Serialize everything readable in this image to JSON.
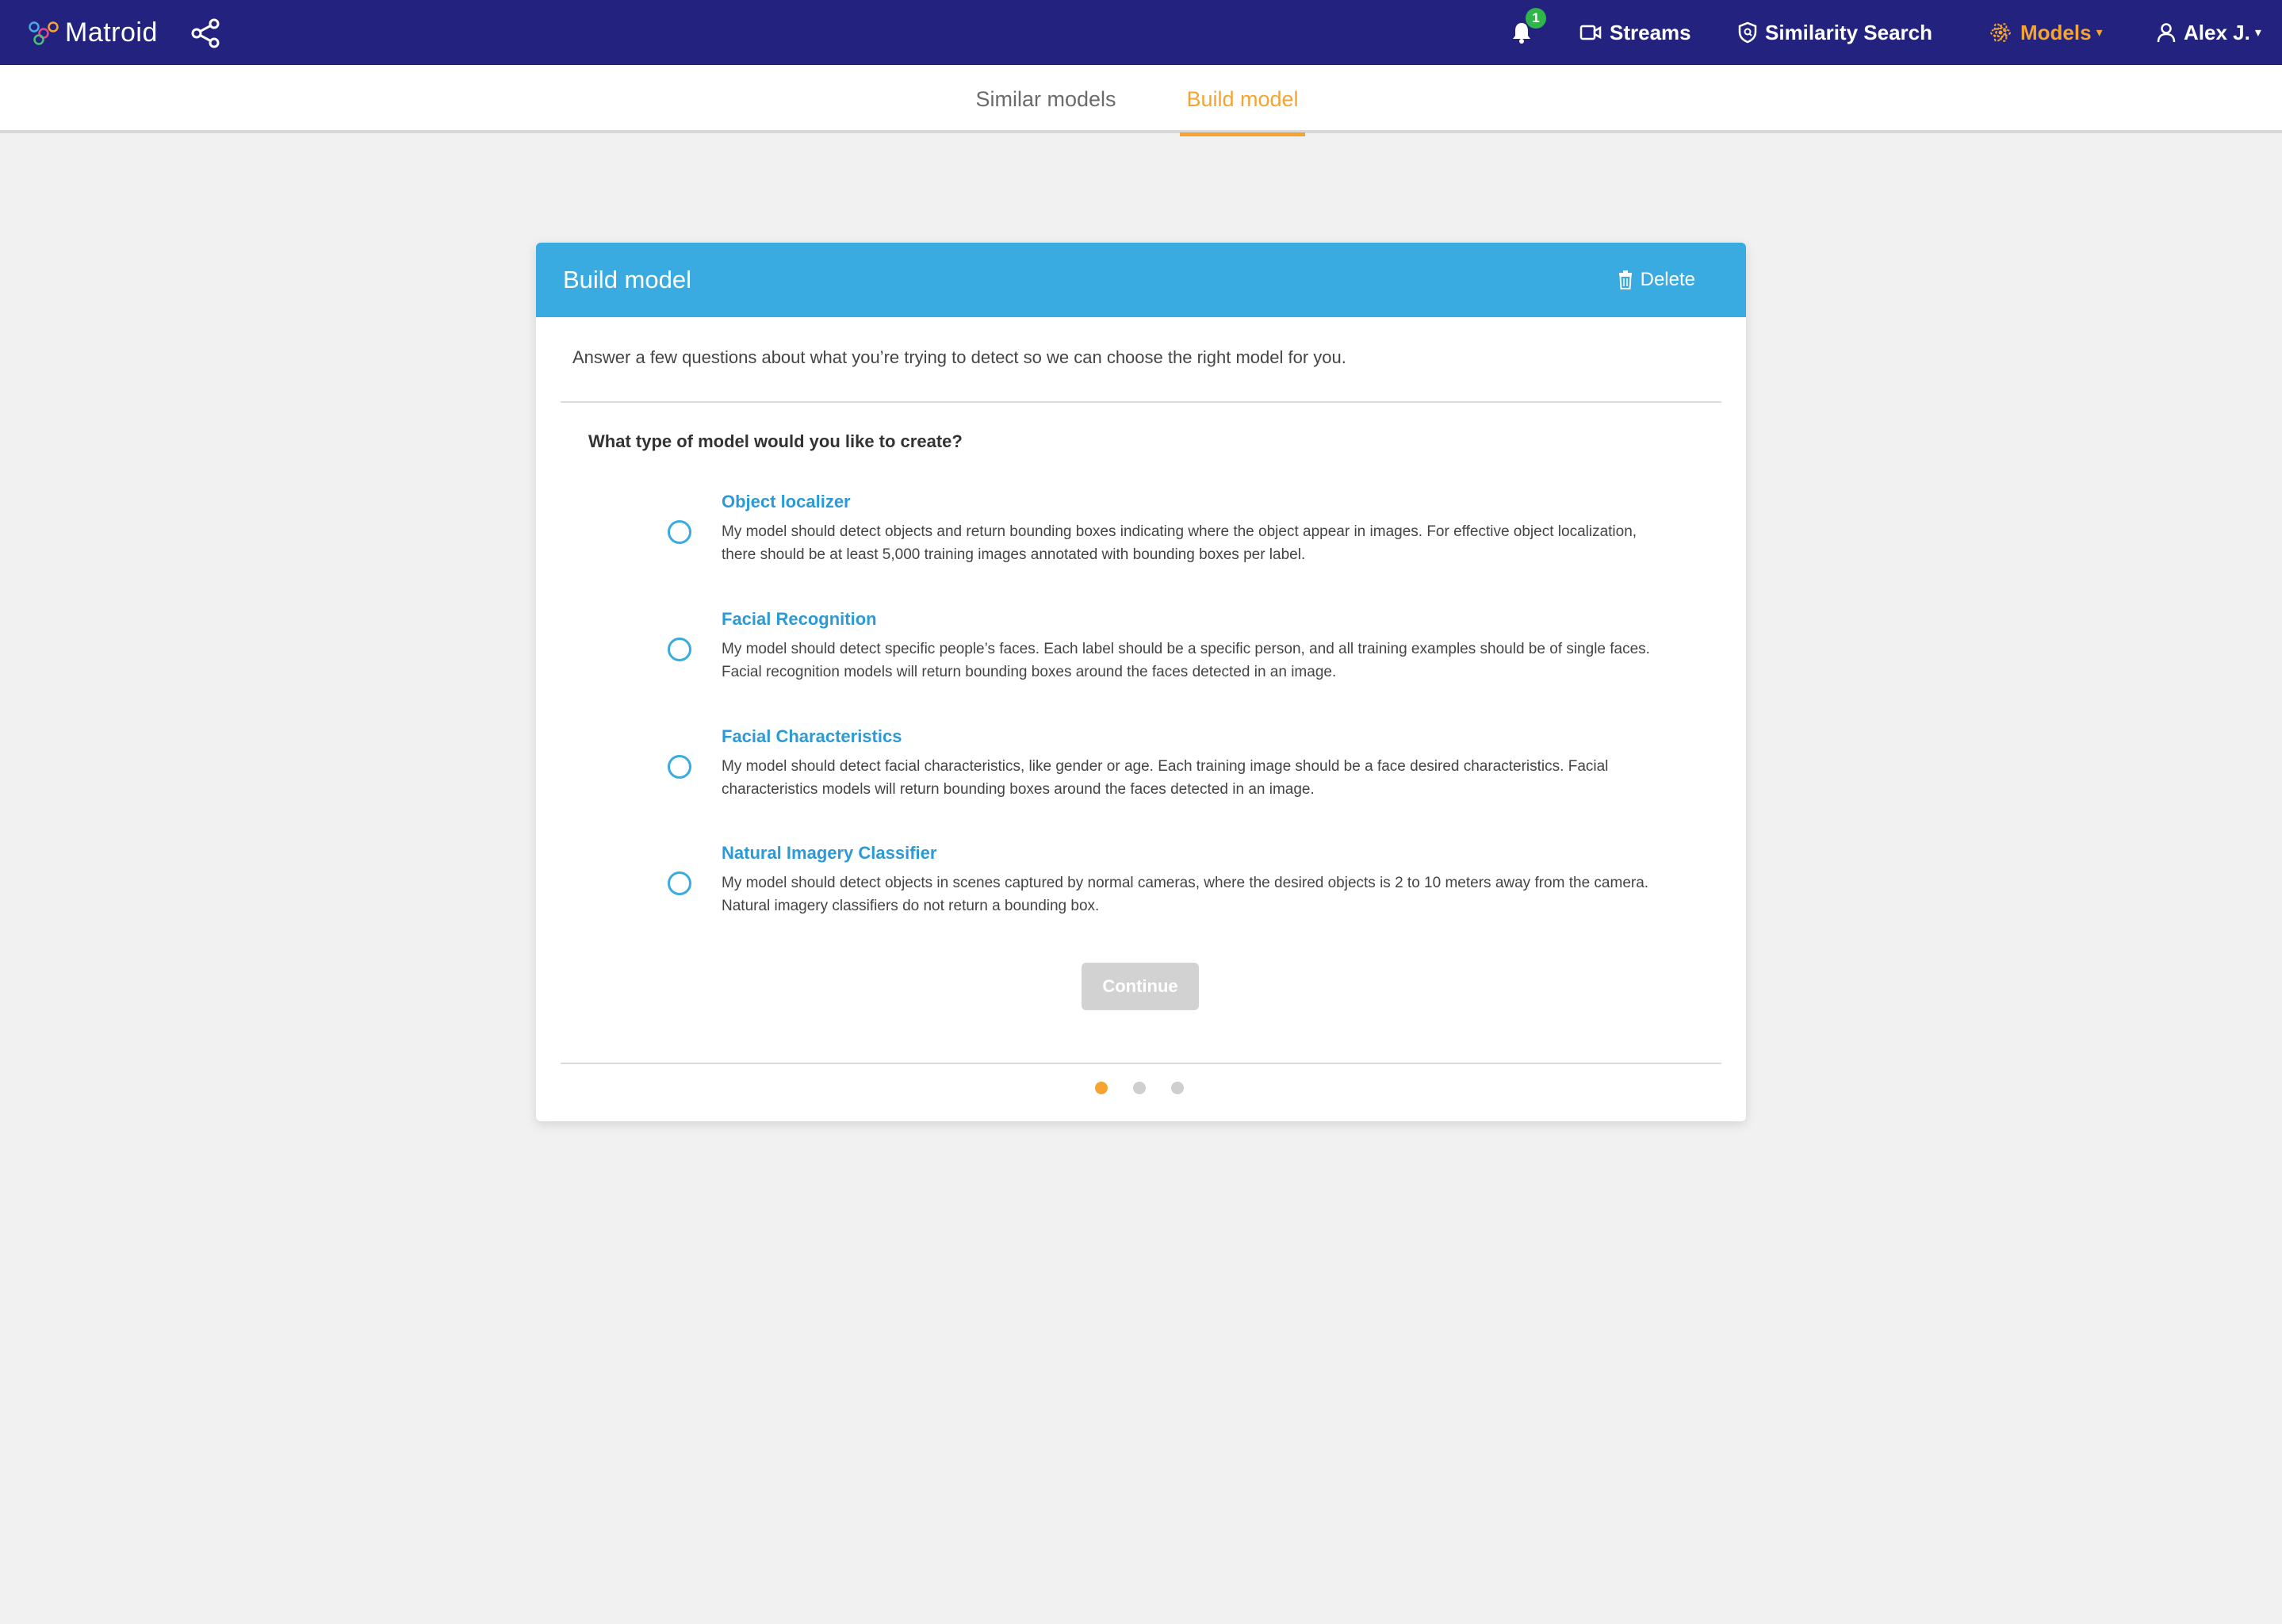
{
  "app": {
    "brand": "Matroid"
  },
  "nav": {
    "notification_count": "1",
    "streams": "Streams",
    "similarity_search": "Similarity Search",
    "models": "Models",
    "user": "Alex J."
  },
  "tabs": [
    {
      "label": "Similar models",
      "active": false
    },
    {
      "label": "Build model",
      "active": true
    }
  ],
  "card": {
    "title": "Build model",
    "delete_label": "Delete",
    "intro": "Answer a few questions about what you’re trying to detect so we can choose the right model for you.",
    "question": "What type of model would you like to create?",
    "options": [
      {
        "title": "Object localizer",
        "description": "My model should detect objects and return bounding boxes indicating where the object appear in images. For effective object localization, there should be at least 5,000 training images annotated with bounding boxes per label."
      },
      {
        "title": "Facial Recognition",
        "description": "My model should detect specific people’s faces. Each label should be a specific person, and all training examples should be of single faces. Facial recognition models will return bounding boxes around the faces detected in an image."
      },
      {
        "title": "Facial Characteristics",
        "description": "My model should detect facial characteristics, like gender or age. Each training image should be a face desired characteristics. Facial characteristics models will return bounding boxes around the faces detected in an image."
      },
      {
        "title": "Natural Imagery Classifier",
        "description": "My model should detect objects in scenes captured by normal cameras, where the desired objects is 2 to 10 meters away from the camera. Natural imagery classifiers do not return a bounding box."
      }
    ],
    "continue_label": "Continue",
    "steps_total": 3,
    "step_current": 1
  },
  "colors": {
    "nav_bg": "#23237f",
    "accent_orange": "#f5a431",
    "header_blue": "#3aabe0",
    "link_blue": "#2b9ad6",
    "badge_green": "#2fb54a"
  }
}
